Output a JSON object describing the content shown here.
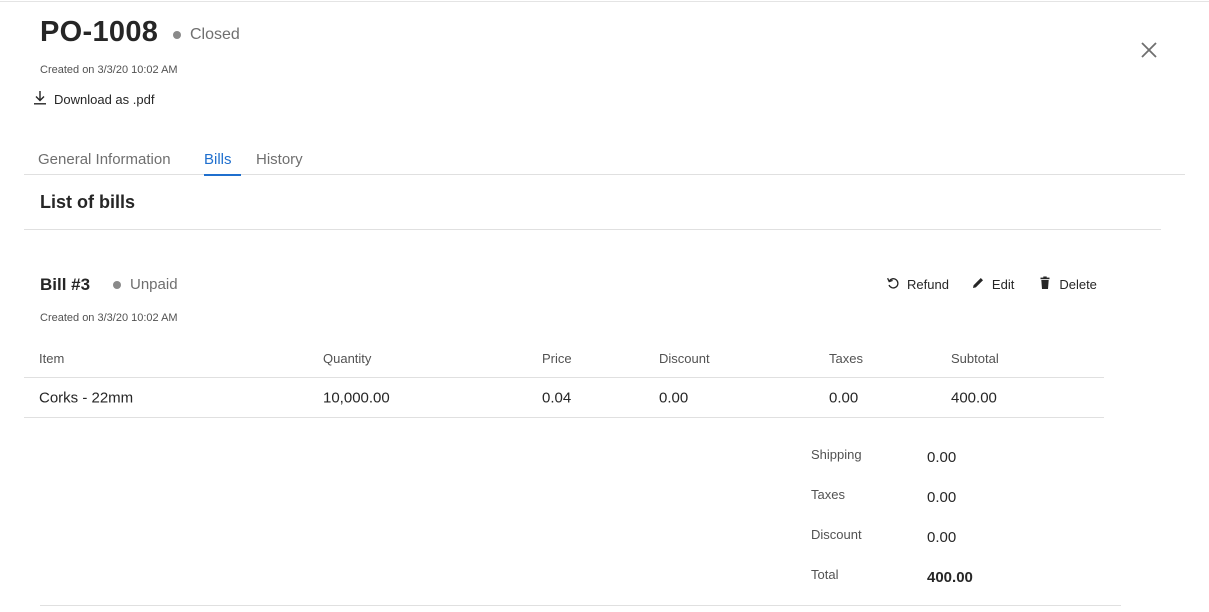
{
  "header": {
    "po_number": "PO-1008",
    "status": "Closed",
    "created": "Created on 3/3/20 10:02 AM",
    "download_label": "Download as .pdf"
  },
  "tabs": [
    {
      "label": "General Information",
      "active": false
    },
    {
      "label": "Bills",
      "active": true
    },
    {
      "label": "History",
      "active": false
    }
  ],
  "section": {
    "title": "List of bills"
  },
  "bill": {
    "title": "Bill #3",
    "status": "Unpaid",
    "created": "Created on 3/3/20 10:02 AM",
    "actions": {
      "refund": "Refund",
      "edit": "Edit",
      "delete": "Delete"
    },
    "table": {
      "headers": [
        "Item",
        "Quantity",
        "Price",
        "Discount",
        "Taxes",
        "Subtotal"
      ],
      "rows": [
        [
          "Corks - 22mm",
          "10,000.00",
          "0.04",
          "0.00",
          "0.00",
          "400.00"
        ]
      ]
    },
    "summary": [
      {
        "label": "Shipping",
        "value": "0.00"
      },
      {
        "label": "Taxes",
        "value": "0.00"
      },
      {
        "label": "Discount",
        "value": "0.00"
      },
      {
        "label": "Total",
        "value": "400.00"
      }
    ]
  },
  "colors": {
    "accent": "#1f6fce",
    "text": "#262626",
    "muted": "#6f6f6f",
    "status_dot": "#8a8a8a",
    "divider": "#e0e0e0"
  },
  "icons": {
    "download": "download-icon",
    "close": "close-icon",
    "refund": "refund-icon",
    "edit": "pencil-icon",
    "delete": "trash-icon"
  }
}
